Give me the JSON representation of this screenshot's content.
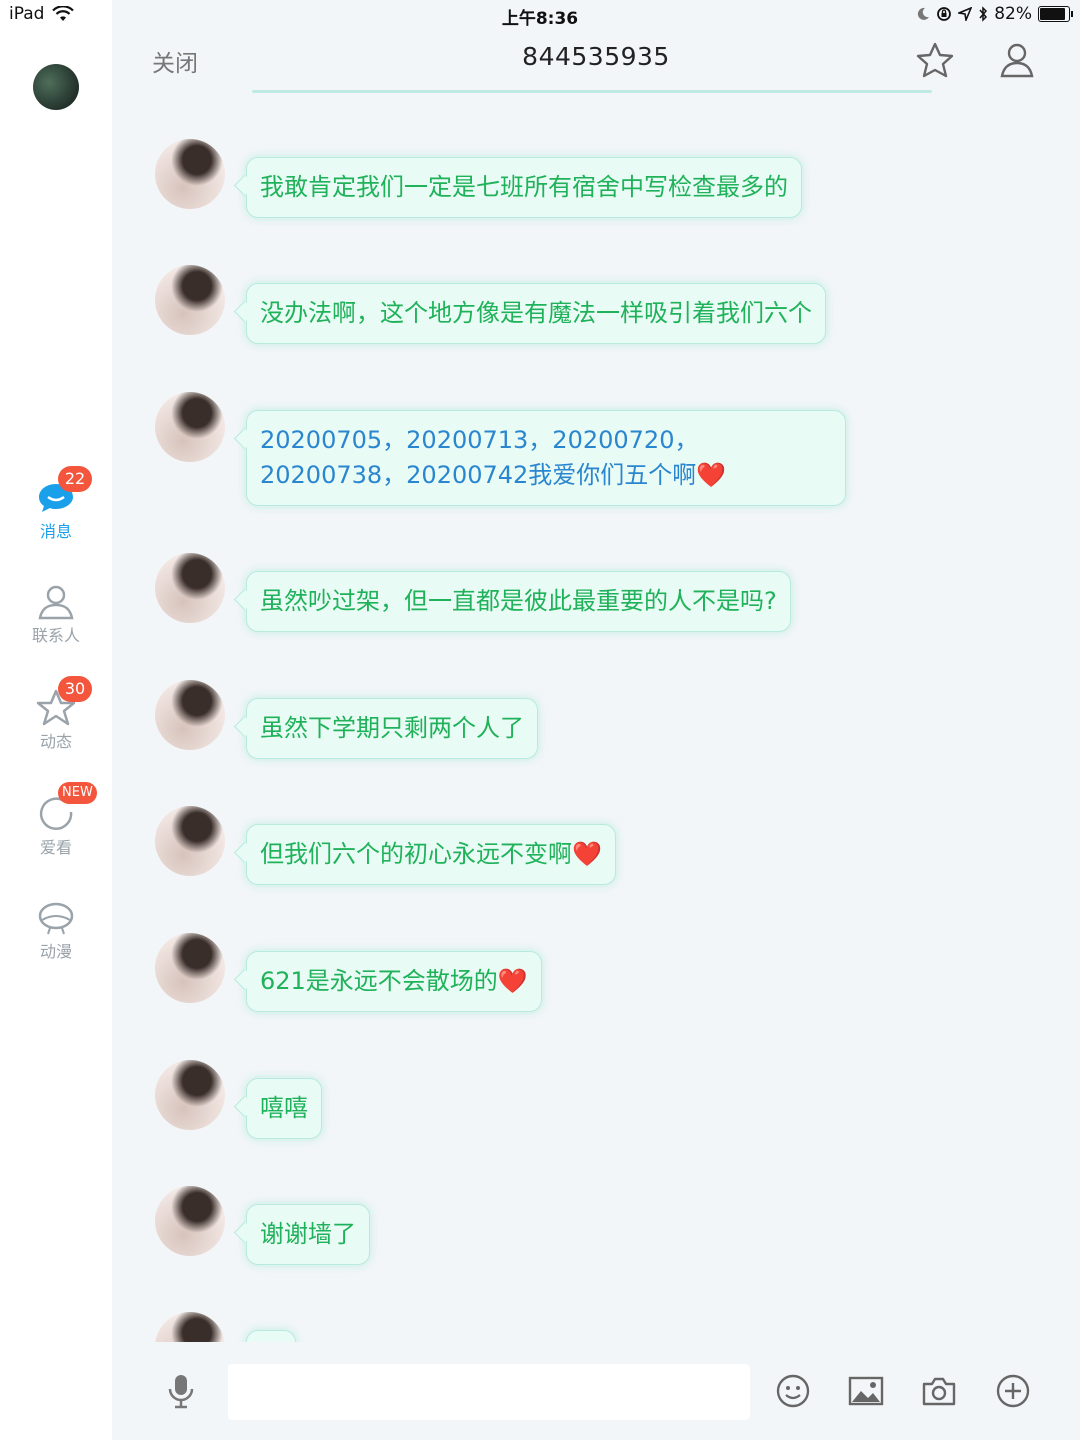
{
  "status_bar": {
    "device": "iPad",
    "time": "上午8:36",
    "battery": "82%",
    "battery_level": 0.82
  },
  "header": {
    "close_label": "关闭",
    "title": "844535935"
  },
  "sidebar": {
    "items": [
      {
        "label": "消息",
        "badge": "22"
      },
      {
        "label": "联系人",
        "badge": ""
      },
      {
        "label": "动态",
        "badge": "30"
      },
      {
        "label": "爱看",
        "badge": "NEW"
      },
      {
        "label": "动漫",
        "badge": ""
      }
    ]
  },
  "messages": [
    {
      "text": "我敢肯定我们一定是七班所有宿舍中写检查最多的"
    },
    {
      "text": "没办法啊，这个地方像是有魔法一样吸引着我们六个"
    },
    {
      "text": "20200705，20200713，20200720，20200738，20200742我爱你们五个啊"
    },
    {
      "text": "虽然吵过架，但一直都是彼此最重要的人不是吗?"
    },
    {
      "text": "虽然下学期只剩两个人了"
    },
    {
      "text": "但我们六个的初心永远不变啊"
    },
    {
      "text": "621是永远不会散场的"
    },
    {
      "text": "嘻嘻"
    },
    {
      "text": "谢谢墙了"
    }
  ],
  "emoji": {
    "heart": "❤️"
  },
  "input": {
    "value": "",
    "placeholder": ""
  },
  "colors": {
    "accent": "#1aa0ea",
    "bubble_text": "#20b25a",
    "link_text": "#2a86cf",
    "badge": "#f4563d"
  }
}
